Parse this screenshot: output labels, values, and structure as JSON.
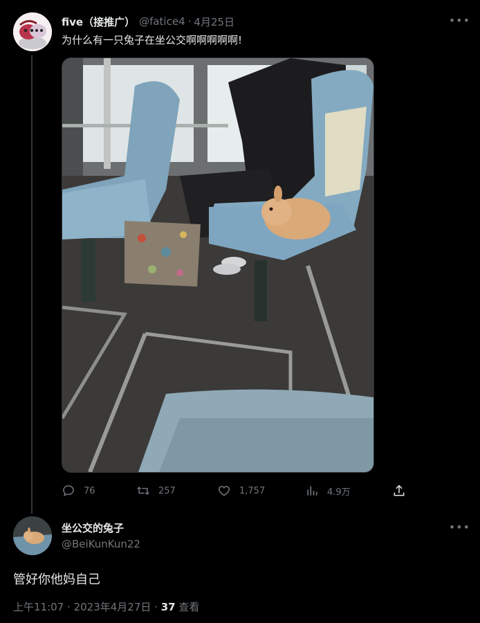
{
  "original_tweet": {
    "display_name": "five（接推广）",
    "handle": "@fatice4",
    "separator": "·",
    "date": "4月25日",
    "text": "为什么有一只兔子在坐公交啊啊啊啊啊!",
    "image_alt": "Rabbit sitting on a bus seat",
    "stats": {
      "replies": "76",
      "retweets": "257",
      "likes": "1,757",
      "views": "4.9万"
    }
  },
  "reply_tweet": {
    "display_name": "坐公交的兔子",
    "handle": "@BeiKunKun22",
    "text": "管好你他妈自己",
    "time": "上午11:07",
    "separator": "·",
    "date": "2023年4月27日",
    "separator2": "·",
    "view_count": "37",
    "view_label": "查看"
  },
  "icons": {
    "reply": "comment-icon",
    "retweet": "retweet-icon",
    "like": "heart-icon",
    "views": "bar-chart-icon",
    "share": "share-icon",
    "more": "more-horizontal-icon"
  },
  "colors": {
    "background": "#000000",
    "primary_text": "#e7e9ea",
    "secondary_text": "#71767b",
    "divider": "#333639"
  }
}
